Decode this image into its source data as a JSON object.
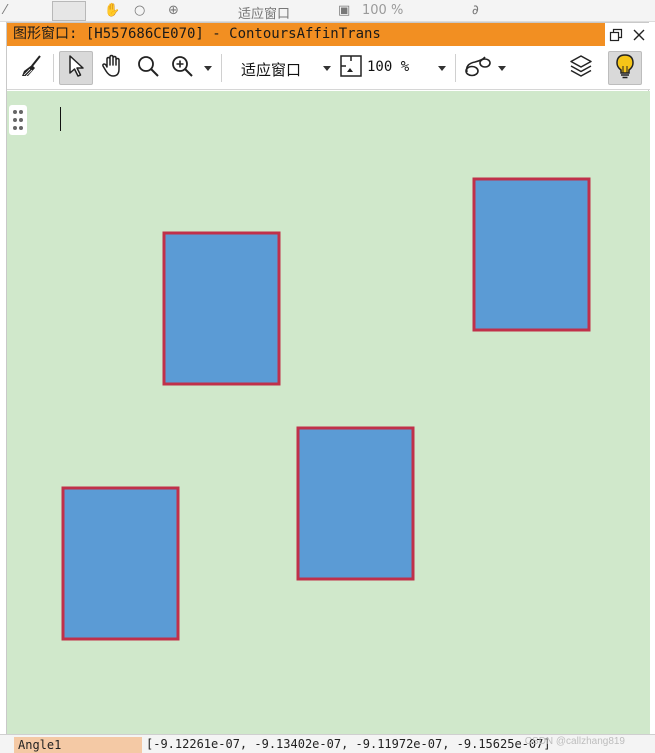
{
  "window": {
    "title": "图形窗口: [H557686CE070] - ContoursAffinTrans",
    "restore_icon": "restore-icon",
    "close_icon": "close-icon"
  },
  "background_toolbar": {
    "fit_label": "适应窗口",
    "zoom_label": "100 %"
  },
  "toolbar": {
    "items": [
      {
        "name": "clear-tool",
        "icon": "broom-icon"
      },
      {
        "name": "select-tool",
        "icon": "pointer-icon",
        "active": true
      },
      {
        "name": "pan-tool",
        "icon": "hand-icon"
      },
      {
        "name": "zoom-tool",
        "icon": "magnifier-icon"
      },
      {
        "name": "zoom-in-tool",
        "icon": "zoom-in-icon",
        "dropdown": true
      },
      {
        "name": "fit-window-select",
        "icon": "chevron-down-icon"
      },
      {
        "name": "zoom-percent-select",
        "icon": "fit-frame-icon"
      },
      {
        "name": "draw-mode-tool",
        "icon": "region-shape-icon",
        "dropdown": true
      },
      {
        "name": "layers-tool",
        "icon": "layers-icon"
      },
      {
        "name": "hint-tool",
        "icon": "lightbulb-icon",
        "active": true
      }
    ],
    "fit_label": "适应窗口",
    "zoom_label": "100 %"
  },
  "canvas": {
    "background": "#d0e8cb",
    "fill_color": "#5b9bd5",
    "border_color": "#c0304a",
    "regions": 4
  },
  "statusbar": {
    "label": "Angle1",
    "value": "[-9.12261e-07, -9.13402e-07, -9.11972e-07, -9.15625e-07]",
    "watermark": "CSDN @callzhang819"
  },
  "colors": {
    "title_bar": "#f28f22",
    "lightbulb": "#f5c518",
    "status_label_bg": "#f4c9a5"
  }
}
